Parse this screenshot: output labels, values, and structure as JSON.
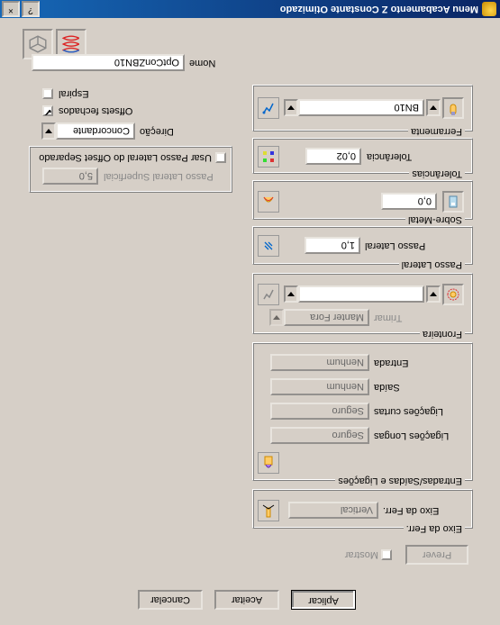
{
  "window": {
    "title": "Menu Acabamento Z Constante Otimizado",
    "help": "?",
    "close": "×"
  },
  "name": {
    "label": "Nome",
    "value": "OptConZBN10"
  },
  "espiral_label": "Espiral",
  "offsets_fechados_label": "Offsets fechados",
  "direcao": {
    "label": "Direção",
    "value": "Concordante"
  },
  "usar_passo": {
    "label": "Usar Passo Lateral do Offset Separado",
    "sub": "Passo Lateral Superficial",
    "value": "5,0"
  },
  "ferramenta": {
    "legend": "Ferramenta",
    "value": "BN10"
  },
  "tolerancias": {
    "legend": "Tolerâncias",
    "label": "Tolerância",
    "value": "0,02"
  },
  "sobremetal": {
    "legend": "Sobre-Metal",
    "value": "0,0"
  },
  "passolateral": {
    "legend": "Passo Lateral",
    "label": "Passo Lateral",
    "value": "1,0"
  },
  "fronteira": {
    "legend": "Fronteira",
    "trimar": "Trimar",
    "trimar_val": "Manter Fora"
  },
  "esl": {
    "legend": "Entradas/Saídas e Ligações",
    "entrada": "Entrada",
    "entrada_v": "Nenhum",
    "saida": "Saída",
    "saida_v": "Nenhum",
    "curtas": "Ligações curtas",
    "curtas_v": "Seguro",
    "longas": "Ligações Longas",
    "longas_v": "Seguro"
  },
  "eixo": {
    "legend": "Eixo da Ferr.",
    "label": "Eixo da Ferr.",
    "value": "Vertical"
  },
  "prever": "Prever",
  "mostrar": "Mostrar",
  "aplicar": "Aplicar",
  "aceitar": "Aceitar",
  "cancelar": "Cancelar"
}
